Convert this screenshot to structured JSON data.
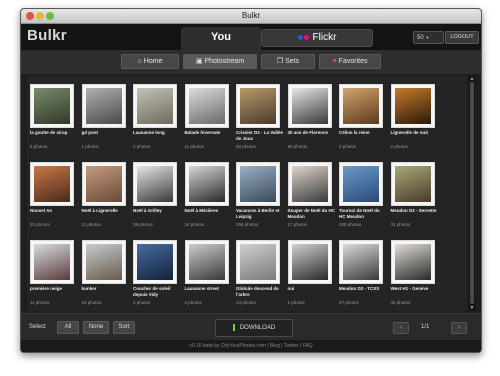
{
  "window": {
    "title": "Bulkr"
  },
  "app": {
    "logo": "Bulkr"
  },
  "tabs": {
    "you": "You",
    "flickr": "Flickr"
  },
  "header": {
    "size_value": "50",
    "logout_label": "LOGOUT"
  },
  "nav": [
    {
      "label": "Home",
      "icon": "home-icon"
    },
    {
      "label": "Photostream",
      "icon": "photostream-icon"
    },
    {
      "label": "Sets",
      "icon": "sets-icon"
    },
    {
      "label": "Favorites",
      "icon": "heart-icon"
    }
  ],
  "sets": [
    {
      "title": "la goutte de sirop",
      "count": "5 photos",
      "colors": [
        "#7a8a6a",
        "#2f3a28"
      ]
    },
    {
      "title": "gd pont",
      "count": "1 photos",
      "colors": [
        "#b0b0b0",
        "#4a4a4a"
      ]
    },
    {
      "title": "Lausanne long",
      "count": "2 photos",
      "colors": [
        "#c5c2b6",
        "#6e6a5c"
      ]
    },
    {
      "title": "Balade hivernale",
      "count": "11 photos",
      "colors": [
        "#dcdcdc",
        "#6a6a6a"
      ]
    },
    {
      "title": "Crissier D2 - La Vallée de Joux",
      "count": "63 photos",
      "colors": [
        "#b89a6a",
        "#4a3a2a"
      ]
    },
    {
      "title": "30 ans de Florence",
      "count": "90 photos",
      "colors": [
        "#e6e6e6",
        "#3a3a3a"
      ]
    },
    {
      "title": "Céline la reine",
      "count": "2 photos",
      "colors": [
        "#d2a46c",
        "#5c3a1e"
      ]
    },
    {
      "title": "Lignerolle de nuit",
      "count": "2 photos",
      "colors": [
        "#c87a2a",
        "#2a1a0a"
      ]
    },
    {
      "title": "Nouvel An",
      "count": "32 photos",
      "colors": [
        "#c87848",
        "#4a2a1a"
      ]
    },
    {
      "title": "Noël à Lignerolle",
      "count": "11 photos",
      "colors": [
        "#c49a7c",
        "#6a4a3a"
      ]
    },
    {
      "title": "Noël à Grilley",
      "count": "39 photos",
      "colors": [
        "#e6e6e6",
        "#3a3a3a"
      ]
    },
    {
      "title": "Noël à Mézières",
      "count": "34 photos",
      "colors": [
        "#d6d6d6",
        "#2a2a2a"
      ]
    },
    {
      "title": "Vacances à Berlin et Leipzig",
      "count": "266 photos",
      "colors": [
        "#9ab0c6",
        "#3a4a5a"
      ]
    },
    {
      "title": "Souper de Noël du HC Meudon",
      "count": "17 photos",
      "colors": [
        "#e0d4c8",
        "#3a3a3a"
      ]
    },
    {
      "title": "Tournoi de Noël du HC Meudon",
      "count": "108 photos",
      "colors": [
        "#6a9ac8",
        "#2a4a7a"
      ]
    },
    {
      "title": "Meudon D2 - Servette",
      "count": "31 photos",
      "colors": [
        "#a8aa78",
        "#4a3a2a"
      ]
    },
    {
      "title": "première neige",
      "count": "11 photos",
      "colors": [
        "#d8dde0",
        "#5a3a3a"
      ]
    },
    {
      "title": "bunker",
      "count": "10 photos",
      "colors": [
        "#c6ccd2",
        "#6a5a4a"
      ]
    },
    {
      "title": "Coucher de soleil depuis Vidy",
      "count": "3 photos",
      "colors": [
        "#4a6aa0",
        "#12223a"
      ]
    },
    {
      "title": "Lausanne street",
      "count": "3 photos",
      "colors": [
        "#cccccc",
        "#3a3a3a"
      ]
    },
    {
      "title": "Globule descend de l'arbre",
      "count": "14 photos",
      "colors": [
        "#cfcfcf",
        "#7a7a7a"
      ]
    },
    {
      "title": "oui",
      "count": "1 photos",
      "colors": [
        "#d0d0d0",
        "#2a2a2a"
      ]
    },
    {
      "title": "Meudon D2 - TCSS",
      "count": "47 photos",
      "colors": [
        "#dadada",
        "#3a3a3a"
      ]
    },
    {
      "title": "West H1 - Genève",
      "count": "43 photos",
      "colors": [
        "#e0ddd4",
        "#2a2a2a"
      ]
    }
  ],
  "bottom": {
    "select_label": "Select",
    "all_label": "All",
    "none_label": "None",
    "sort_label": "Sort",
    "download_label": "DOWNLOAD",
    "prev": "<",
    "page": "1/1",
    "next": ">"
  },
  "footer": {
    "text": "v0.16 beta by CityYourPhotos.com  |  Blog  |  Twitter  |  FAQ"
  }
}
